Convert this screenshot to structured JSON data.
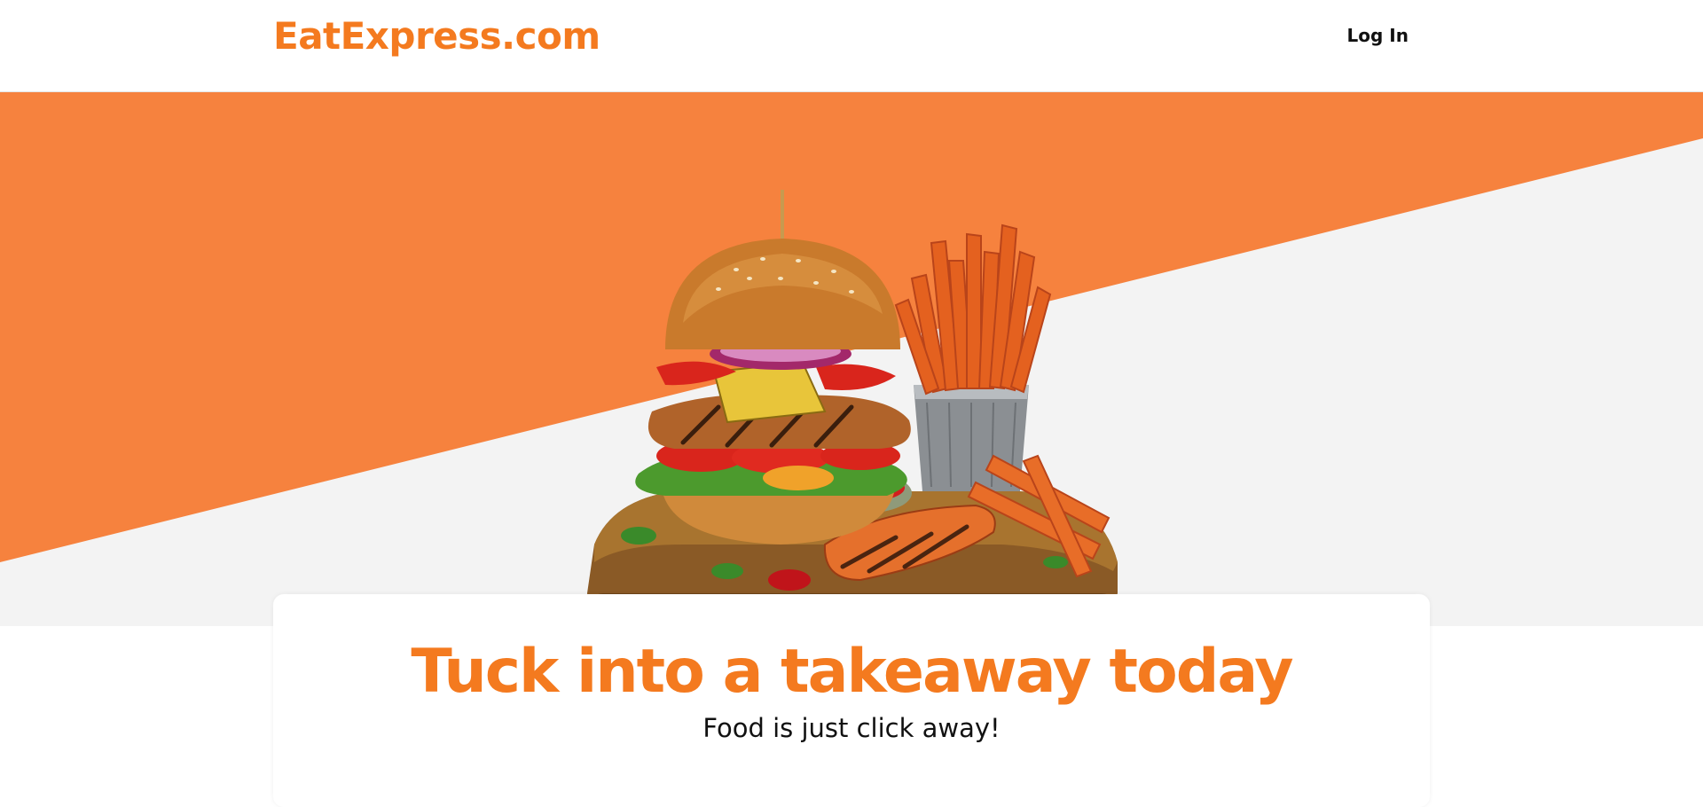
{
  "header": {
    "logo": "EatExpress.com",
    "login_label": "Log In"
  },
  "hero": {
    "image_alt": "Grilled chicken burger with sweet potato fries on a wooden board"
  },
  "card": {
    "title": "Tuck into a takeaway today",
    "subtitle": "Food is just click away!"
  },
  "colors": {
    "brand_orange": "#f47a1f",
    "hero_orange": "#f6823e",
    "hero_grey": "#f3f3f3"
  }
}
